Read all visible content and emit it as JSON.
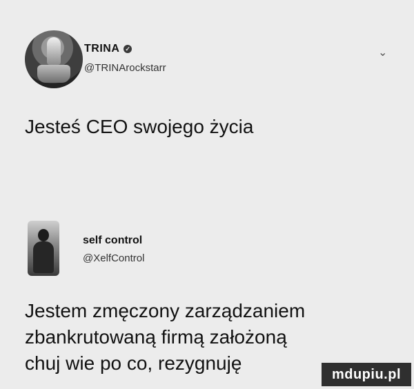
{
  "tweet1": {
    "name": "TRINA",
    "handle": "@TRINArockstarr",
    "text": "Jesteś CEO swojego życia"
  },
  "tweet2": {
    "name": "self control",
    "handle": "@XelfControl",
    "lines": [
      "Jestem zmęczony zarządzaniem",
      "zbankrutowaną firmą założoną",
      "chuj wie po co, rezygnuję"
    ]
  },
  "watermark": "mdupiu.pl",
  "icons": {
    "verified": "verified-badge-icon",
    "menu": "chevron-down-icon"
  }
}
